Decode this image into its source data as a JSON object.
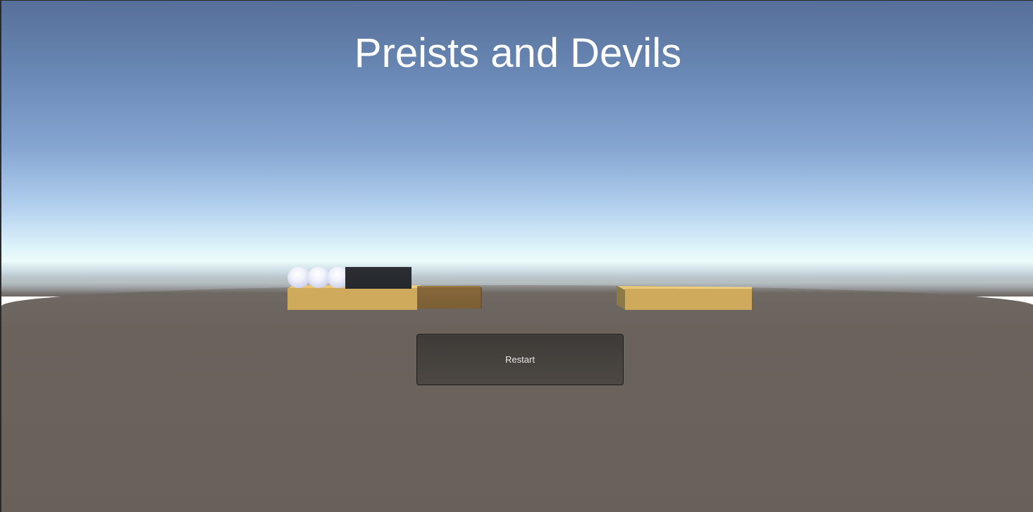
{
  "game": {
    "title": "Preists and Devils",
    "restart_label": "Restart"
  },
  "scene": {
    "left_bank": {
      "priests": 3,
      "devils": 1
    },
    "boat": {
      "side": "left",
      "passengers": 0
    },
    "right_bank": {
      "priests": 0,
      "devils": 0
    }
  },
  "colors": {
    "bank": "#cfa95c",
    "boat": "#7c5f34",
    "priest": "#f1f2fb",
    "devil": "#25282c",
    "button": "#45413d"
  }
}
